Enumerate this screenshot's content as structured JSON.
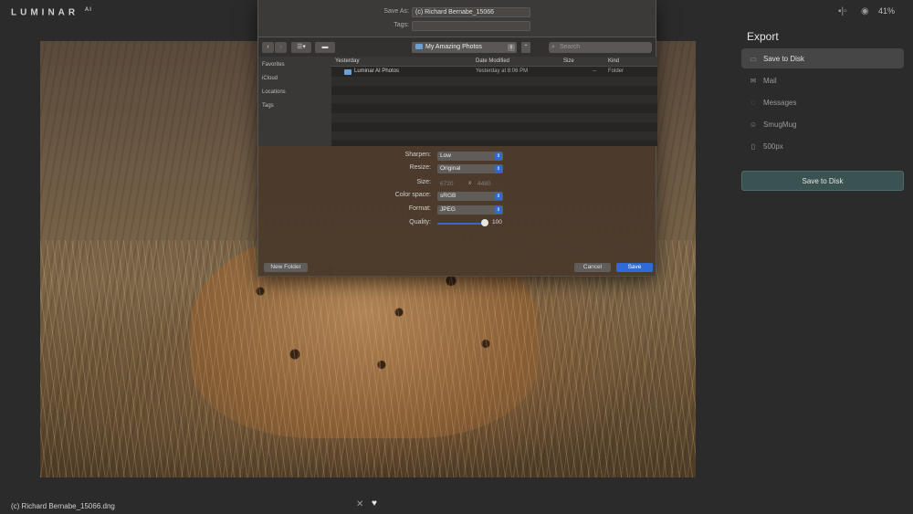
{
  "app": {
    "logo": "LUMINAR",
    "logo_sup": "AI",
    "zoom": "41%"
  },
  "photo": {
    "filename": "(c) Richard Bernabe_15066.dng"
  },
  "export_panel": {
    "title": "Export",
    "items": [
      {
        "label": "Save to Disk",
        "icon": "folder-icon",
        "active": true
      },
      {
        "label": "Mail",
        "icon": "mail-icon",
        "active": false
      },
      {
        "label": "Messages",
        "icon": "messages-icon",
        "active": false
      },
      {
        "label": "SmugMug",
        "icon": "smugmug-icon",
        "active": false
      },
      {
        "label": "500px",
        "icon": "500px-icon",
        "active": false
      }
    ],
    "action_button": "Save to Disk"
  },
  "save_dialog": {
    "save_as_label": "Save As:",
    "save_as_value": "(c) Richard Bernabe_15066",
    "tags_label": "Tags:",
    "location": "My Amazing Photos",
    "search_placeholder": "Search",
    "sidebar": [
      "Favorites",
      "iCloud",
      "Locations",
      "Tags"
    ],
    "columns": [
      "Yesterday",
      "Date Modified",
      "Size",
      "Kind"
    ],
    "rows": [
      {
        "name": "Luminar AI Photos",
        "date": "Yesterday at 8:06 PM",
        "size": "--",
        "kind": "Folder"
      }
    ],
    "options": {
      "sharpen_label": "Sharpen:",
      "sharpen_value": "Low",
      "resize_label": "Resize:",
      "resize_value": "Original",
      "size_label": "Size:",
      "size_w": "6720",
      "size_x": "x",
      "size_h": "4480",
      "colorspace_label": "Color space:",
      "colorspace_value": "sRGB",
      "format_label": "Format:",
      "format_value": "JPEG",
      "quality_label": "Quality:",
      "quality_value": "100",
      "quality_level": 100
    },
    "new_folder": "New Folder",
    "cancel": "Cancel",
    "save": "Save"
  }
}
